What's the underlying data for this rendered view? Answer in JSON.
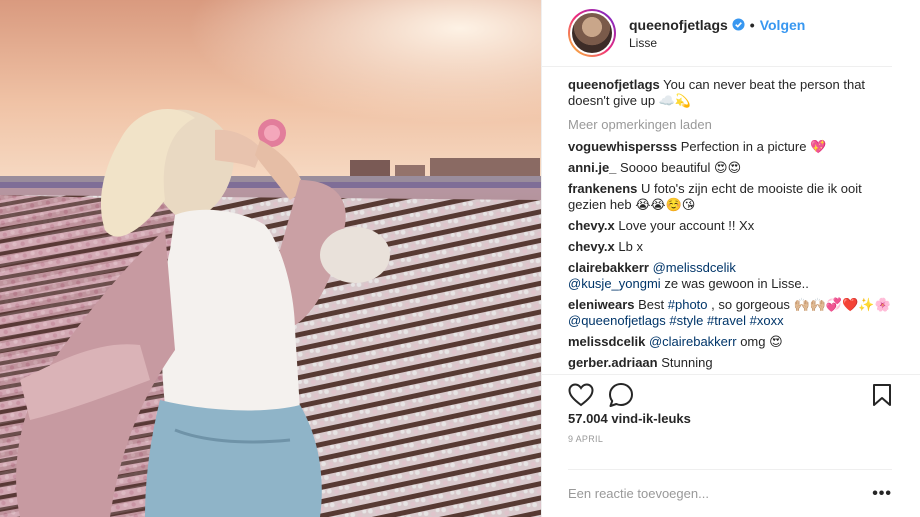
{
  "header": {
    "username": "queenofjetlags",
    "separator": "•",
    "follow_label": "Volgen",
    "location": "Lisse"
  },
  "caption": {
    "username": "queenofjetlags",
    "text": "You can never beat the person that doesn't give up ☁️💫"
  },
  "load_more": "Meer opmerkingen laden",
  "comments": [
    {
      "username": "voguewhispersss",
      "text": "Perfection in a picture 💖"
    },
    {
      "username": "anni.je_",
      "text": "Soooo beautiful 😍😍"
    },
    {
      "username": "frankenens",
      "text": "U foto's zijn echt de mooiste die ik ooit gezien heb 😭😭☺️😘"
    },
    {
      "username": "chevy.x",
      "text": "Love your account !! Xx"
    },
    {
      "username": "chevy.x",
      "text": "Lb x"
    },
    {
      "username": "clairebakkerr",
      "mention1": "@melissdcelik",
      "mention2": "@kusje_yongmi",
      "text": "ze was gewoon in Lisse.."
    },
    {
      "username": "eleniwears",
      "pre": "Best",
      "tag1": "#photo",
      "mid": ", so gorgeous 🙌🏼🙌🏼💞❤️✨🌸",
      "mention": "@queenofjetlags",
      "tag2": "#style",
      "tag3": "#travel",
      "tag4": "#xoxx"
    },
    {
      "username": "melissdcelik",
      "mention": "@clairebakkerr",
      "text": "omg 😍"
    },
    {
      "username": "gerber.adriaan",
      "text": "Stunning"
    }
  ],
  "likes": "57.004 vind-ik-leuks",
  "date": "9 APRIL",
  "comment_placeholder": "Een reactie toevoegen...",
  "options_label": "•••",
  "colors": {
    "link": "#3897f0",
    "tag": "#003569",
    "muted": "#999999",
    "border": "#efefef"
  }
}
